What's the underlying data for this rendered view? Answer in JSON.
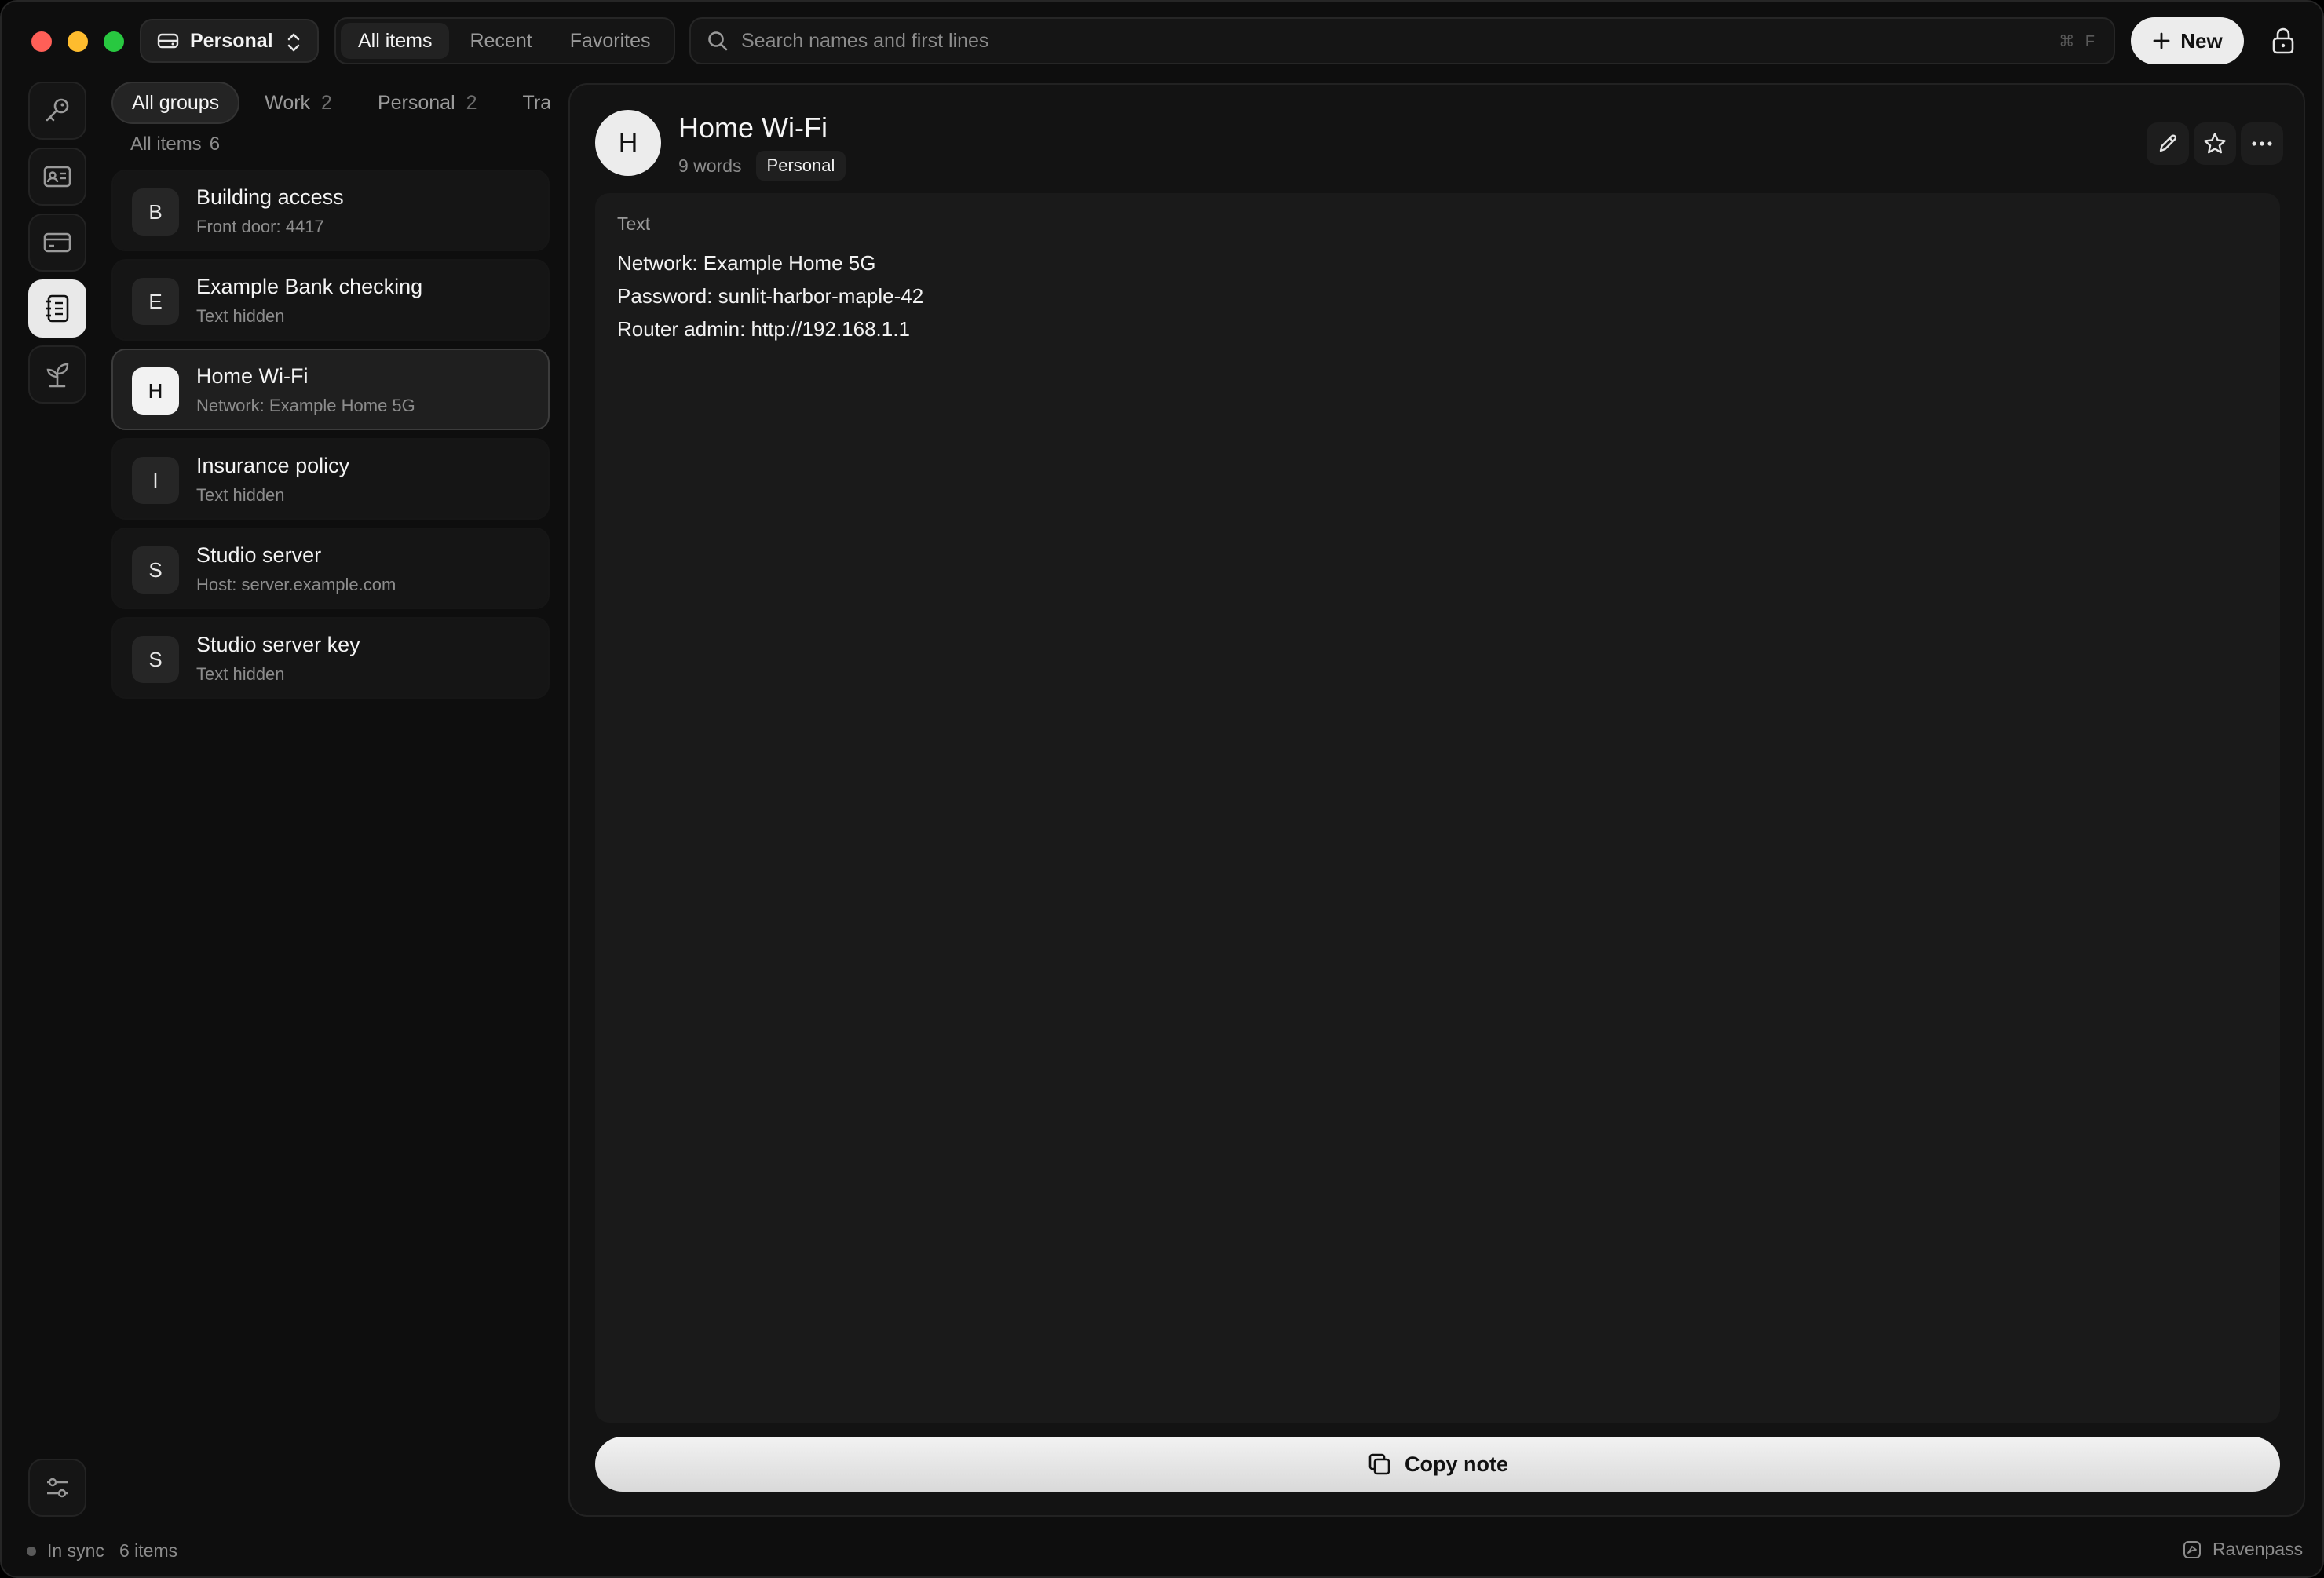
{
  "titlebar": {
    "vault_name": "Personal",
    "scope_tabs": [
      "All items",
      "Recent",
      "Favorites"
    ],
    "search_placeholder": "Search names and first lines",
    "search_shortcut": "⌘ F",
    "new_label": "New"
  },
  "rail": {
    "items": [
      "key-icon",
      "id-card-icon",
      "credit-card-icon",
      "notes-icon",
      "sprout-icon"
    ],
    "active": "notes-icon",
    "bottom": "sliders-icon"
  },
  "groups": {
    "tabs": [
      {
        "label": "All groups",
        "count": ""
      },
      {
        "label": "Work",
        "count": "2"
      },
      {
        "label": "Personal",
        "count": "2"
      },
      {
        "label": "Travel",
        "count": ""
      }
    ],
    "list_heading": "All items",
    "list_count": "6"
  },
  "items": [
    {
      "letter": "B",
      "title": "Building access",
      "subtitle": "Front door: 4417"
    },
    {
      "letter": "E",
      "title": "Example Bank checking",
      "subtitle": "Text hidden"
    },
    {
      "letter": "H",
      "title": "Home Wi-Fi",
      "subtitle": "Network: Example Home 5G"
    },
    {
      "letter": "I",
      "title": "Insurance policy",
      "subtitle": "Text hidden"
    },
    {
      "letter": "S",
      "title": "Studio server",
      "subtitle": "Host: server.example.com"
    },
    {
      "letter": "S",
      "title": "Studio server key",
      "subtitle": "Text hidden"
    }
  ],
  "selected_index": 2,
  "detail": {
    "letter": "H",
    "title": "Home Wi-Fi",
    "words": "9 words",
    "tag": "Personal",
    "field_label": "Text",
    "lines": [
      "Network: Example Home 5G",
      "Password: sunlit-harbor-maple-42",
      "Router admin: http://192.168.1.1"
    ],
    "copy_label": "Copy note"
  },
  "footer": {
    "sync_status": "In sync",
    "item_count": "6 items",
    "brand": "Ravenpass"
  },
  "colors": {
    "window_bg": "#0e0e0e",
    "panel_bg": "#131313",
    "accent_light": "#ececec",
    "muted_text": "#8c8c8c"
  }
}
